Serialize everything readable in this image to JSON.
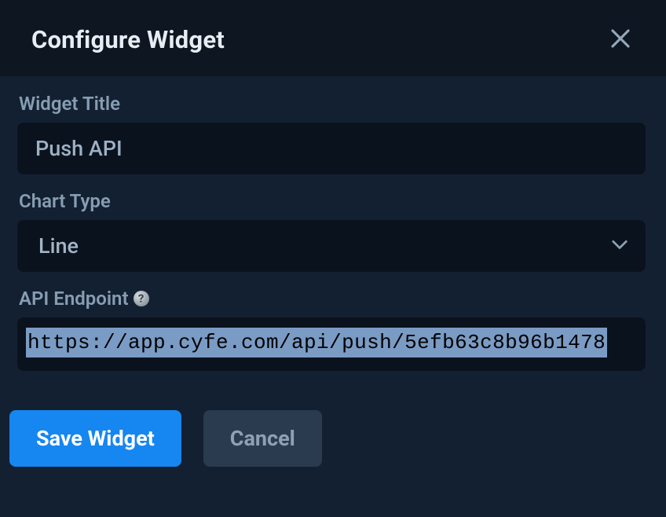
{
  "header": {
    "title": "Configure Widget"
  },
  "form": {
    "widget_title": {
      "label": "Widget Title",
      "value": "Push API"
    },
    "chart_type": {
      "label": "Chart Type",
      "value": "Line"
    },
    "api_endpoint": {
      "label": "API Endpoint",
      "help_glyph": "?",
      "value": "https://app.cyfe.com/api/push/5efb63c8b96b1478"
    }
  },
  "footer": {
    "save_label": "Save Widget",
    "cancel_label": "Cancel"
  }
}
